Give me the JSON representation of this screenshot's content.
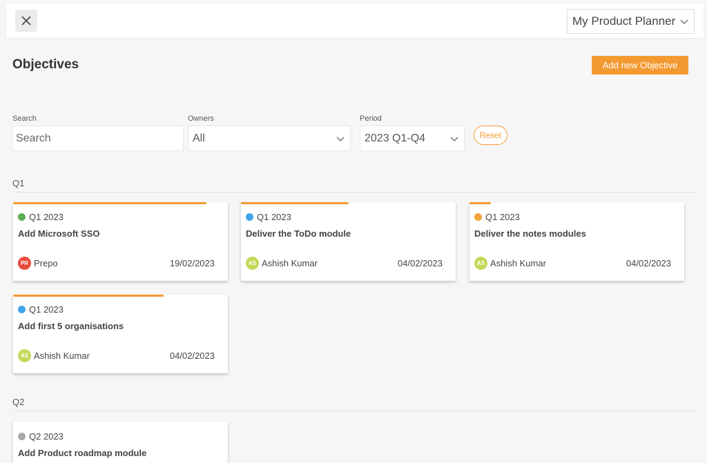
{
  "header": {
    "planner_select": "My Product Planner"
  },
  "page": {
    "title": "Objectives",
    "add_button": "Add new Objective"
  },
  "filters": {
    "search_label": "Search",
    "search_placeholder": "Search",
    "owners_label": "Owners",
    "owners_value": "All",
    "period_label": "Period",
    "period_value": "2023 Q1-Q4",
    "reset_label": "Reset"
  },
  "sections": [
    {
      "label": "Q1",
      "cards": [
        {
          "quarter": "Q1 2023",
          "status_color": "#5cae55",
          "title": "Add Microsoft SSO",
          "owner_initials": "PR",
          "owner_name": "Prepo",
          "avatar_color": "#e84a3a",
          "date": "19/02/2023",
          "progress": 0.9
        },
        {
          "quarter": "Q1 2023",
          "status_color": "#3fa4ea",
          "title": "Deliver the ToDo module",
          "owner_initials": "AS",
          "owner_name": "Ashish Kumar",
          "avatar_color": "#c3d95a",
          "date": "04/02/2023",
          "progress": 0.5
        },
        {
          "quarter": "Q1 2023",
          "status_color": "#f4a23a",
          "title": "Deliver the notes modules",
          "owner_initials": "AS",
          "owner_name": "Ashish Kumar",
          "avatar_color": "#c3d95a",
          "date": "04/02/2023",
          "progress": 0.1
        },
        {
          "quarter": "Q1 2023",
          "status_color": "#3fa4ea",
          "title": "Add first 5 organisations",
          "owner_initials": "AS",
          "owner_name": "Ashish Kumar",
          "avatar_color": "#c3d95a",
          "date": "04/02/2023",
          "progress": 0.7
        }
      ]
    },
    {
      "label": "Q2",
      "cards": [
        {
          "quarter": "Q2 2023",
          "status_color": "#a8a8a8",
          "title": "Add Product roadmap module",
          "owner_initials": "",
          "owner_name": "",
          "avatar_color": "",
          "date": "",
          "progress": 0
        }
      ]
    }
  ],
  "colors": {
    "accent": "#f49a32",
    "background": "#f6f6f6"
  }
}
